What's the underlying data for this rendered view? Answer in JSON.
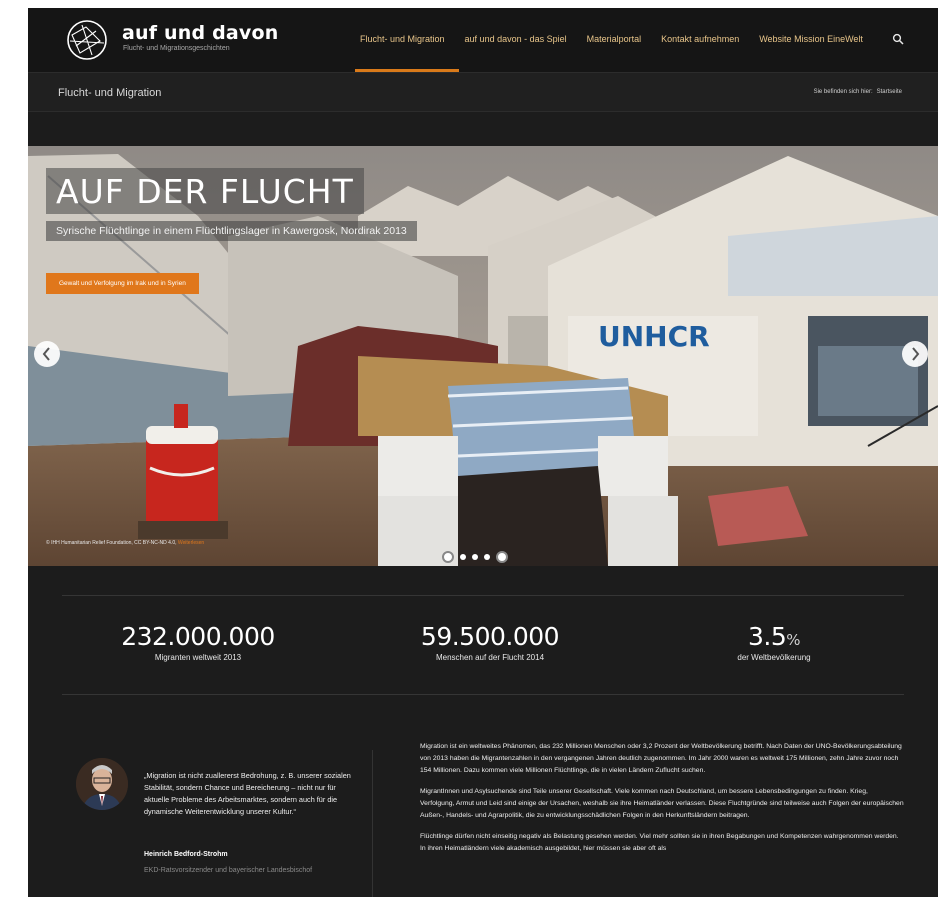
{
  "header": {
    "brand_name": "auf und davon",
    "brand_tagline": "Flucht- und Migrationsgeschichten",
    "nav": [
      {
        "label": "Flucht- und Migration",
        "active": true
      },
      {
        "label": "auf und davon - das Spiel",
        "active": false
      },
      {
        "label": "Materialportal",
        "active": false
      },
      {
        "label": "Kontakt aufnehmen",
        "active": false
      },
      {
        "label": "Website Mission EineWelt",
        "active": false
      }
    ],
    "search_icon": "search-icon",
    "accent_color": "#d97a1a"
  },
  "subbar": {
    "page_title": "Flucht- und Migration",
    "breadcrumb_prefix": "Sie befinden sich hier:",
    "breadcrumb_current": "Startseite"
  },
  "hero": {
    "headline": "AUF DER FLUCHT",
    "subheadline": "Syrische Flüchtlinge in einem Flüchtlingslager in Kawergosk, Nordirak 2013",
    "cta_label": "Gewalt und Verfolgung im Irak und in Syrien",
    "credit_text": "© IHH Humanitarian Relief Foundation, CC BY-NC-ND 4.0,",
    "credit_license": "Weiterlesen",
    "tent_text": "UNHCR",
    "slides": 5,
    "active_slide": 5,
    "prev_icon": "chevron-left-icon",
    "next_icon": "chevron-right-icon"
  },
  "stats": [
    {
      "value": "232.000.000",
      "unit": "",
      "label": "Migranten weltweit 2013"
    },
    {
      "value": "59.500.000",
      "unit": "",
      "label": "Menschen auf der Flucht 2014"
    },
    {
      "value": "3.5",
      "unit": "%",
      "label": "der Weltbevölkerung"
    }
  ],
  "quote": {
    "text": "„Migration ist nicht zuallererst Bedrohung, z. B. unserer sozialen Stabilität, sondern Chance und Bereicherung – nicht nur für aktuelle Probleme des Arbeitsmarktes, sondern auch für die dynamische Weiterentwicklung unserer Kultur.“",
    "author": "Heinrich Bedford-Strohm",
    "role": "EKD-Ratsvorsitzender und bayerischer Landesbischof"
  },
  "article": {
    "paragraphs": [
      "Migration ist ein weltweites Phänomen, das 232 Millionen Menschen oder 3,2 Prozent der Weltbevölkerung betrifft. Nach Daten der UNO-Bevölkerungsabteilung von 2013 haben die Migrantenzahlen in den vergangenen Jahren deutlich zugenommen. Im Jahr 2000 waren es weltweit 175 Millionen, zehn Jahre zuvor noch 154 Millionen. Dazu kommen viele Millionen Flüchtlinge, die in vielen Ländern Zuflucht suchen.",
      "MigrantInnen und Asylsuchende sind Teile unserer Gesellschaft. Viele kommen nach Deutschland, um bessere Lebensbedingungen zu finden. Krieg, Verfolgung, Armut und Leid sind einige der Ursachen, weshalb sie ihre Heimatländer verlassen. Diese Fluchtgründe sind teilweise auch Folgen der europäischen Außen-, Handels- und Agrarpolitik, die zu entwicklungsschädlichen Folgen in den Herkunftsländern beitragen.",
      "Flüchtlinge dürfen nicht einseitig negativ als Belastung gesehen werden. Viel mehr sollten sie in ihren Begabungen und Kompetenzen wahrgenommen werden. In ihren Heimatländern viele akademisch ausgebildet, hier müssen sie aber oft als"
    ]
  }
}
